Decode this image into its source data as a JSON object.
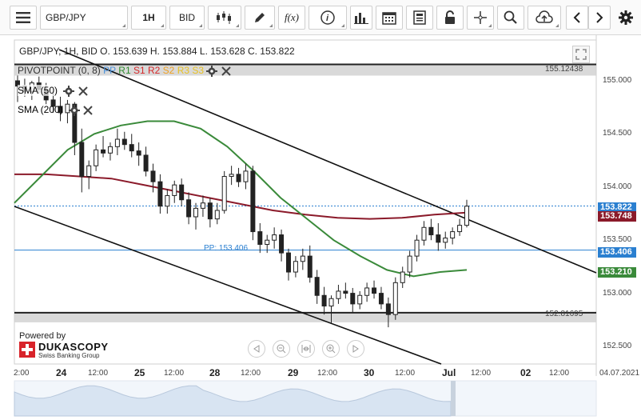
{
  "toolbar": {
    "menu_icon": "menu-icon",
    "symbol": "GBP/JPY",
    "timeframe": "1H",
    "price_type": "BID",
    "chart_type_icon": "candlestick-icon",
    "draw_icon": "pencil-icon",
    "function_label": "f(x)",
    "info_icon": "info-icon",
    "bars_icon": "bar-chart-icon",
    "calendar_icon": "calendar-icon",
    "news_icon": "document-icon",
    "lock_icon": "lock-icon",
    "crosshair_icon": "crosshair-icon",
    "zoom_icon": "zoom-icon",
    "cloud_icon": "cloud-upload-icon",
    "prev_icon": "chevron-left-icon",
    "next_icon": "chevron-right-icon",
    "settings_icon": "gear-icon"
  },
  "chart_header": {
    "ohlc": "GBP/JPY, 1H, BID   O. 153.639 H. 153.884 L. 153.628 C. 153.822",
    "pivot_prefix": "PIVOTPOINT (0, 8)",
    "pivot_items": [
      {
        "label": "PP",
        "color": "#4a90d9"
      },
      {
        "label": "R1",
        "color": "#2e8b2e"
      },
      {
        "label": "S1",
        "color": "#d62728"
      },
      {
        "label": "R2",
        "color": "#d62728"
      },
      {
        "label": "S2",
        "color": "#f0a020"
      },
      {
        "label": "R3",
        "color": "#e8c020"
      },
      {
        "label": "S3",
        "color": "#e8c020"
      }
    ],
    "sma50_label": "SMA (50)",
    "sma50_color": "#3a8a3a",
    "sma200_label": "SMA (200)",
    "sma200_color": "#8b1a2a"
  },
  "chart_data": {
    "type": "candlestick",
    "symbol": "GBP/JPY",
    "interval": "1H",
    "ylim": [
      152.42,
      155.2
    ],
    "yticks": [
      "155.000",
      "154.500",
      "154.000",
      "153.500",
      "153.000",
      "152.500"
    ],
    "xticks": [
      "2:00",
      "24",
      "12:00",
      "25",
      "12:00",
      "28",
      "12:00",
      "29",
      "12:00",
      "30",
      "12:00",
      "Jul",
      "12:00",
      "02",
      "12:00",
      "04.07.2021"
    ],
    "bold_xticks": [
      "24",
      "25",
      "28",
      "29",
      "30",
      "Jul",
      "02"
    ],
    "levels": {
      "resistance": "155.12438",
      "support": "152.81695",
      "pivot_label": "PP: 153.406"
    },
    "price_tags": [
      {
        "value": "153.822",
        "color": "#2a7fd0"
      },
      {
        "value": "153.748",
        "color": "#8b1a2a"
      },
      {
        "value": "153.406",
        "color": "#2a7fd0"
      },
      {
        "value": "153.210",
        "color": "#3a8a3a"
      }
    ],
    "candles": [
      [
        155.0,
        155.05,
        154.8,
        154.95
      ],
      [
        154.95,
        155.02,
        154.85,
        154.9
      ],
      [
        154.9,
        155.0,
        154.82,
        154.98
      ],
      [
        154.98,
        155.04,
        154.88,
        154.92
      ],
      [
        154.92,
        154.98,
        154.78,
        154.82
      ],
      [
        154.82,
        154.9,
        154.7,
        154.76
      ],
      [
        154.76,
        154.85,
        154.62,
        154.7
      ],
      [
        154.7,
        154.82,
        154.6,
        154.78
      ],
      [
        154.78,
        154.8,
        154.3,
        154.42
      ],
      [
        154.42,
        154.55,
        153.95,
        154.1
      ],
      [
        154.1,
        154.25,
        153.98,
        154.2
      ],
      [
        154.2,
        154.4,
        154.15,
        154.35
      ],
      [
        154.35,
        154.48,
        154.28,
        154.32
      ],
      [
        154.32,
        154.42,
        154.25,
        154.38
      ],
      [
        154.38,
        154.55,
        154.3,
        154.45
      ],
      [
        154.45,
        154.52,
        154.35,
        154.4
      ],
      [
        154.4,
        154.5,
        154.28,
        154.34
      ],
      [
        154.34,
        154.42,
        154.2,
        154.3
      ],
      [
        154.3,
        154.38,
        154.1,
        154.15
      ],
      [
        154.15,
        154.22,
        153.95,
        154.05
      ],
      [
        154.05,
        154.12,
        153.75,
        153.82
      ],
      [
        153.82,
        153.98,
        153.75,
        153.92
      ],
      [
        153.92,
        154.06,
        153.85,
        154.02
      ],
      [
        154.02,
        154.08,
        153.82,
        153.88
      ],
      [
        153.88,
        153.95,
        153.65,
        153.72
      ],
      [
        153.72,
        153.85,
        153.6,
        153.8
      ],
      [
        153.8,
        153.92,
        153.72,
        153.85
      ],
      [
        153.85,
        153.9,
        153.62,
        153.7
      ],
      [
        153.7,
        153.85,
        153.65,
        153.78
      ],
      [
        153.78,
        154.15,
        153.75,
        154.1
      ],
      [
        154.1,
        154.2,
        154.02,
        154.12
      ],
      [
        154.12,
        154.18,
        154.0,
        154.05
      ],
      [
        154.05,
        154.22,
        153.98,
        154.15
      ],
      [
        154.15,
        154.2,
        153.5,
        153.58
      ],
      [
        153.58,
        153.66,
        153.38,
        153.46
      ],
      [
        153.46,
        153.55,
        153.38,
        153.5
      ],
      [
        153.5,
        153.62,
        153.42,
        153.55
      ],
      [
        153.55,
        153.6,
        153.3,
        153.38
      ],
      [
        153.38,
        153.42,
        153.12,
        153.2
      ],
      [
        153.2,
        153.35,
        153.15,
        153.3
      ],
      [
        153.3,
        153.42,
        153.22,
        153.35
      ],
      [
        153.35,
        153.45,
        153.1,
        153.15
      ],
      [
        153.15,
        153.22,
        152.9,
        152.98
      ],
      [
        152.98,
        153.06,
        152.8,
        152.88
      ],
      [
        152.88,
        152.98,
        152.72,
        152.95
      ],
      [
        152.95,
        153.08,
        152.9,
        153.02
      ],
      [
        153.02,
        153.1,
        152.95,
        153.0
      ],
      [
        153.0,
        153.05,
        152.82,
        152.9
      ],
      [
        152.9,
        153.02,
        152.85,
        152.98
      ],
      [
        152.98,
        153.1,
        152.92,
        153.05
      ],
      [
        153.05,
        153.12,
        152.95,
        153.0
      ],
      [
        153.0,
        153.06,
        152.85,
        152.9
      ],
      [
        152.9,
        152.96,
        152.68,
        152.8
      ],
      [
        152.8,
        153.15,
        152.75,
        153.1
      ],
      [
        153.1,
        153.25,
        153.05,
        153.2
      ],
      [
        153.2,
        153.4,
        153.15,
        153.35
      ],
      [
        153.35,
        153.55,
        153.3,
        153.5
      ],
      [
        153.5,
        153.68,
        153.45,
        153.62
      ],
      [
        153.62,
        153.7,
        153.5,
        153.55
      ],
      [
        153.55,
        153.66,
        153.4,
        153.48
      ],
      [
        153.48,
        153.58,
        153.42,
        153.52
      ],
      [
        153.52,
        153.62,
        153.46,
        153.58
      ],
      [
        153.58,
        153.7,
        153.54,
        153.64
      ],
      [
        153.64,
        153.88,
        153.62,
        153.82
      ]
    ],
    "sma50": [
      153.85,
      154.1,
      154.35,
      154.5,
      154.58,
      154.62,
      154.62,
      154.55,
      154.38,
      154.15,
      153.9,
      153.7,
      153.5,
      153.35,
      153.22,
      153.16,
      153.2,
      153.22
    ],
    "sma200": [
      154.12,
      154.12,
      154.1,
      154.08,
      154.02,
      153.96,
      153.9,
      153.84,
      153.78,
      153.74,
      153.71,
      153.7,
      153.71,
      153.74,
      153.76
    ],
    "channel": {
      "upper": [
        [
          155.0,
          0
        ],
        [
          153.25,
          1
        ]
      ],
      "lower": [
        [
          153.82,
          0
        ],
        [
          152.4,
          1
        ]
      ]
    },
    "navigator_label": "navigator"
  },
  "branding": {
    "powered_by": "Powered by",
    "company": "DUKASCOPY",
    "tagline": "Swiss Banking Group"
  }
}
